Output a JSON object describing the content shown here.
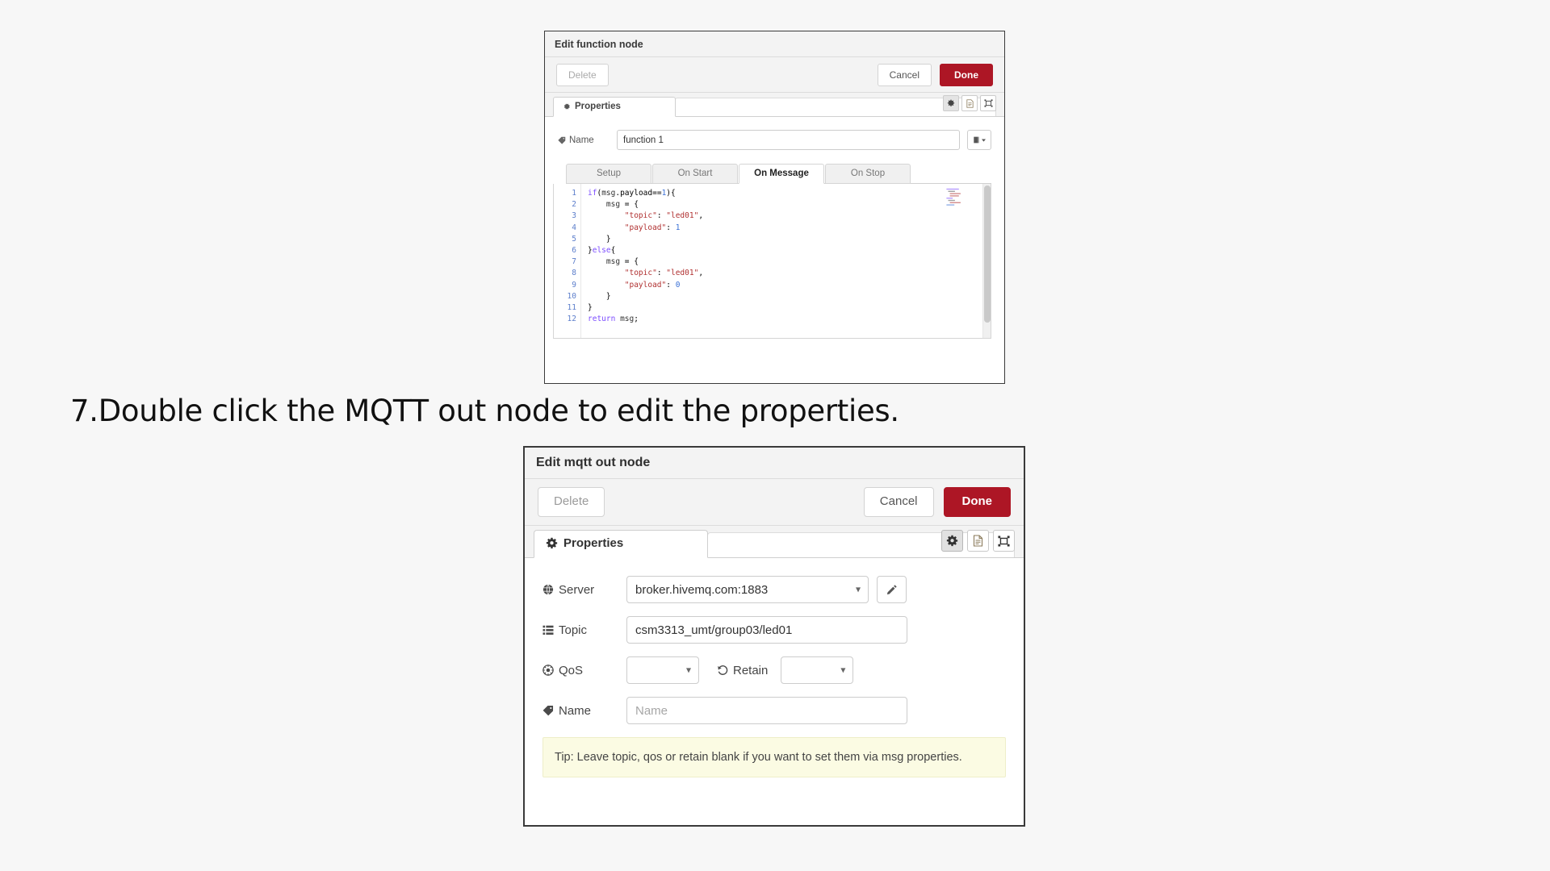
{
  "page": {
    "background": "#f7f7f7",
    "instruction": "7.Double click the MQTT out node to edit the properties."
  },
  "function_dialog": {
    "title": "Edit function node",
    "buttons": {
      "delete": "Delete",
      "cancel": "Cancel",
      "done": "Done"
    },
    "tab": "Properties",
    "icon_buttons": [
      "gear-icon",
      "description-icon",
      "appearance-icon"
    ],
    "name_field": {
      "label": "Name",
      "value": "function 1"
    },
    "sub_tabs": [
      {
        "label": "Setup",
        "active": false,
        "has_icon": true
      },
      {
        "label": "On Start",
        "active": false,
        "has_icon": false
      },
      {
        "label": "On Message",
        "active": true,
        "has_icon": false
      },
      {
        "label": "On Stop",
        "active": false,
        "has_icon": false
      }
    ],
    "code_lines": [
      {
        "n": "1",
        "text": "if(msg.payload==1){"
      },
      {
        "n": "2",
        "text": "    msg = {"
      },
      {
        "n": "3",
        "text": "        \"topic\": \"led01\","
      },
      {
        "n": "4",
        "text": "        \"payload\": 1"
      },
      {
        "n": "5",
        "text": "    }"
      },
      {
        "n": "6",
        "text": "}else{"
      },
      {
        "n": "7",
        "text": "    msg = {"
      },
      {
        "n": "8",
        "text": "        \"topic\": \"led01\","
      },
      {
        "n": "9",
        "text": "        \"payload\": 0"
      },
      {
        "n": "10",
        "text": "    }"
      },
      {
        "n": "11",
        "text": "}"
      },
      {
        "n": "12",
        "text": "return msg;"
      }
    ]
  },
  "mqtt_dialog": {
    "title": "Edit mqtt out node",
    "buttons": {
      "delete": "Delete",
      "cancel": "Cancel",
      "done": "Done"
    },
    "tab": "Properties",
    "icon_buttons": [
      "gear-icon",
      "description-icon",
      "appearance-icon"
    ],
    "fields": {
      "server": {
        "label": "Server",
        "value": "broker.hivemq.com:1883",
        "icon": "globe-icon"
      },
      "topic": {
        "label": "Topic",
        "value": "csm3313_umt/group03/led01",
        "icon": "list-icon"
      },
      "qos": {
        "label": "QoS",
        "value": "",
        "icon": "target-icon"
      },
      "retain": {
        "label": "Retain",
        "value": "",
        "icon": "history-icon"
      },
      "name": {
        "label": "Name",
        "value": "",
        "placeholder": "Name",
        "icon": "tag-icon"
      }
    },
    "tip": "Tip: Leave topic, qos or retain blank if you want to set them via msg properties.",
    "accent_color": "#ad1625",
    "tip_background": "#fbfbe3"
  }
}
